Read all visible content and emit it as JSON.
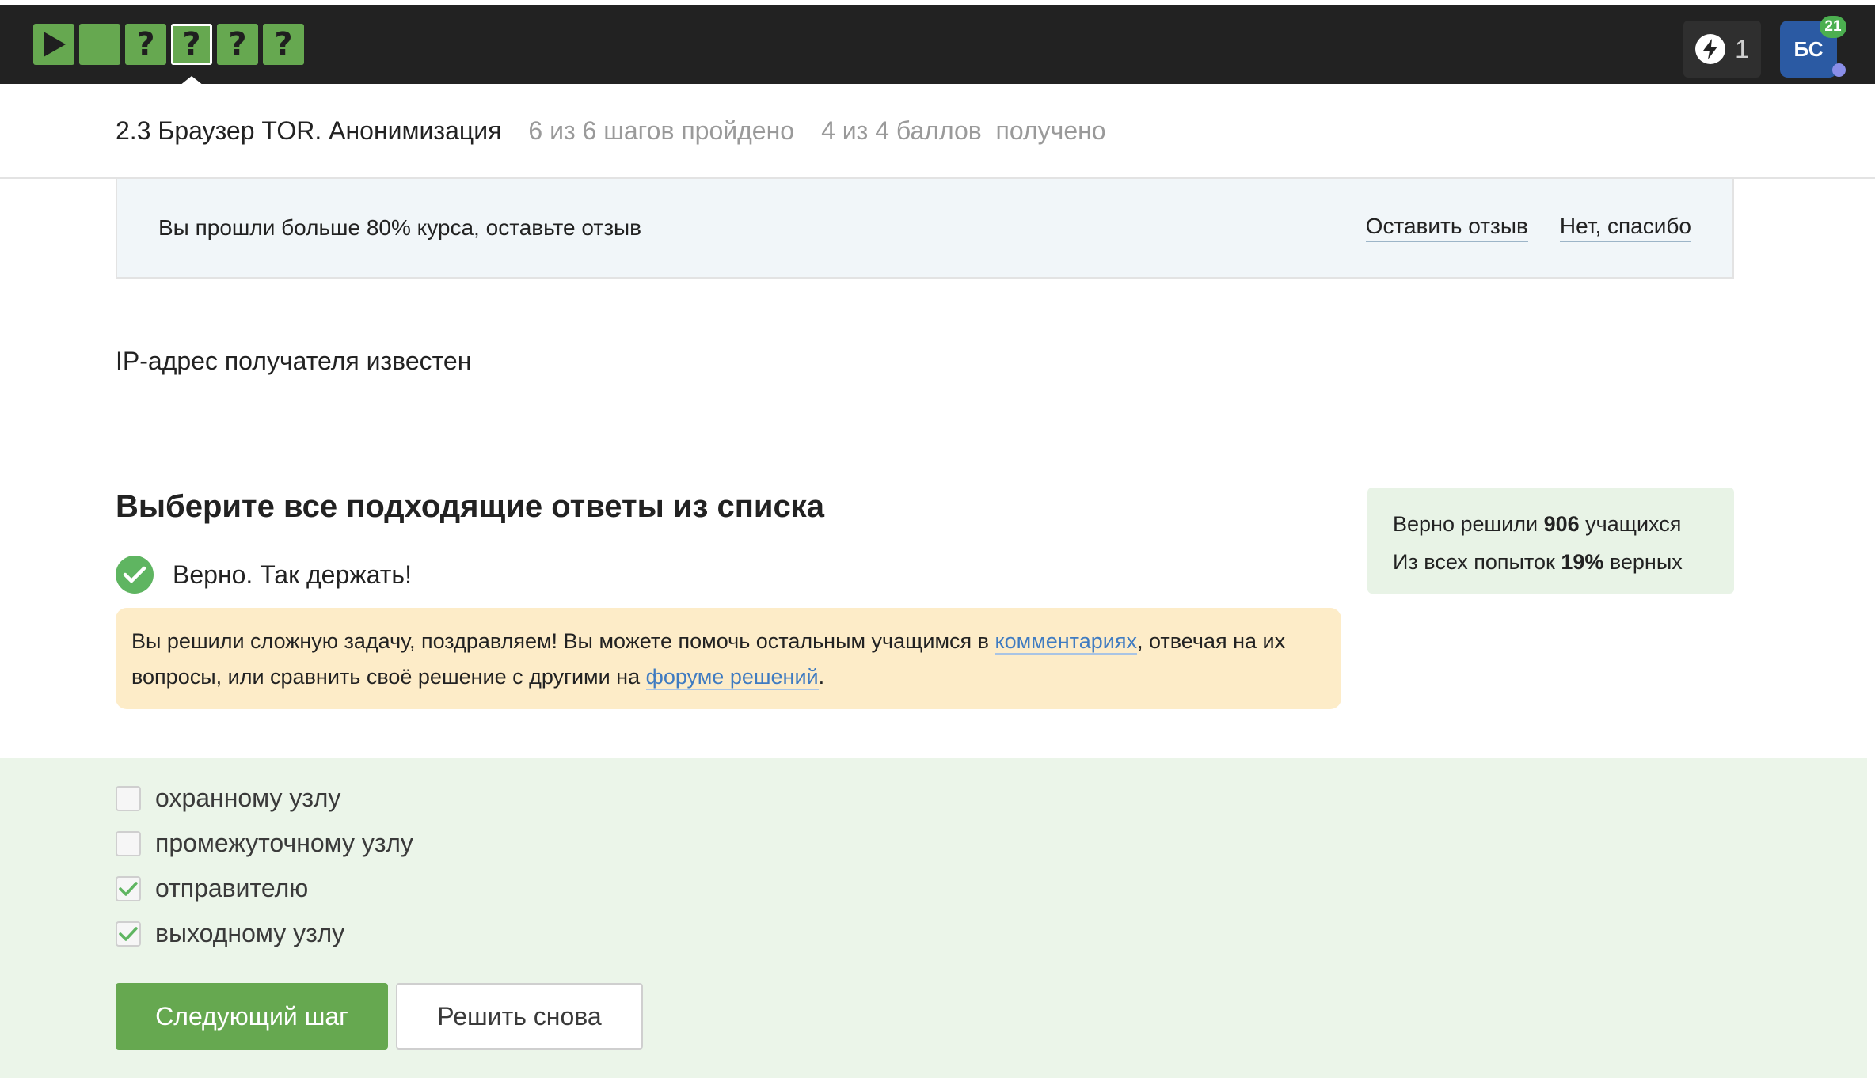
{
  "nav": {
    "steps": [
      {
        "symbol": "▶",
        "status": "passed",
        "type": "video"
      },
      {
        "symbol": "",
        "status": "passed",
        "type": "text"
      },
      {
        "symbol": "?",
        "status": "passed",
        "type": "quiz"
      },
      {
        "symbol": "?",
        "status": "passed-current",
        "type": "quiz"
      },
      {
        "symbol": "?",
        "status": "passed",
        "type": "quiz"
      },
      {
        "symbol": "?",
        "status": "passed",
        "type": "quiz"
      }
    ],
    "energy_count": "1",
    "avatar_initials": "БС",
    "notifications_count": "21"
  },
  "lesson": {
    "title": "2.3 Браузер TOR. Анонимизация",
    "steps_progress": "6 из 6 шагов пройдено",
    "points_progress": "4 из 4 баллов  получено"
  },
  "feedback": {
    "text": "Вы прошли больше 80% курса, оставьте отзыв",
    "leave_review": "Оставить отзыв",
    "decline": "Нет, спасибо"
  },
  "step_text": "IP-адрес получателя известен",
  "quiz": {
    "title": "Выберите все подходящие ответы из списка",
    "result": "Верно. Так держать!",
    "hint_part1": "Вы решили сложную задачу, поздравляем! Вы можете помочь остальным учащимся в ",
    "hint_link_comments": "комментариях",
    "hint_part2": ", отвечая на их вопросы, или сравнить своё решение с другими на ",
    "hint_link_forum": "форуме решений",
    "hint_part3": ".",
    "stats_solved_prefix": "Верно решили ",
    "stats_solved_count": "906",
    "stats_solved_suffix": " учащихся",
    "stats_attempts_prefix": "Из всех попыток ",
    "stats_attempts_percent": "19%",
    "stats_attempts_suffix": " верных",
    "options": [
      {
        "label": "охранному узлу",
        "checked": false
      },
      {
        "label": "промежуточному узлу",
        "checked": false
      },
      {
        "label": "отправителю",
        "checked": true
      },
      {
        "label": "выходному узлу",
        "checked": true
      }
    ],
    "next_button": "Следующий шаг",
    "retry_button": "Решить снова"
  },
  "colors": {
    "accent_green": "#66a850",
    "topbar": "#222222",
    "answers_bg": "#ebf5e9",
    "hint_bg": "#fdecc8",
    "link": "#3f7bc1",
    "avatar_bg": "#2b5aa3"
  }
}
